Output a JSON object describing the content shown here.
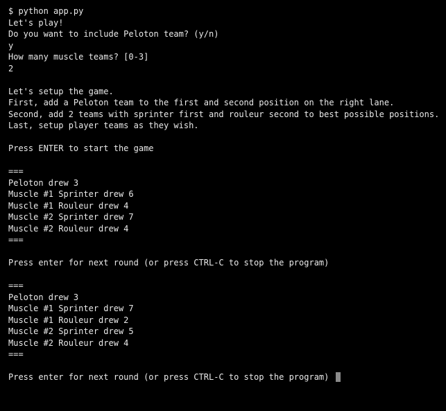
{
  "terminal": {
    "lines": [
      {
        "text": "$ python app.py",
        "name": "command-line"
      },
      {
        "text": "Let's play!",
        "name": "output-line"
      },
      {
        "text": "Do you want to include Peloton team? (y/n)",
        "name": "prompt-peloton"
      },
      {
        "text": "y",
        "name": "input-peloton"
      },
      {
        "text": "How many muscle teams? [0-3]",
        "name": "prompt-muscle-teams"
      },
      {
        "text": "2",
        "name": "input-muscle-teams"
      },
      {
        "text": "",
        "name": "blank-line"
      },
      {
        "text": "Let's setup the game.",
        "name": "output-line"
      },
      {
        "text": "First, add a Peloton team to the first and second position on the right lane.",
        "name": "output-line"
      },
      {
        "text": "Second, add 2 teams with sprinter first and rouleur second to best possible positions.",
        "name": "output-line"
      },
      {
        "text": "Last, setup player teams as they wish.",
        "name": "output-line"
      },
      {
        "text": "",
        "name": "blank-line"
      },
      {
        "text": "Press ENTER to start the game",
        "name": "prompt-start"
      },
      {
        "text": "",
        "name": "blank-line"
      },
      {
        "text": "===",
        "name": "separator"
      },
      {
        "text": "Peloton drew 3",
        "name": "output-line"
      },
      {
        "text": "Muscle #1 Sprinter drew 6",
        "name": "output-line"
      },
      {
        "text": "Muscle #1 Rouleur drew 4",
        "name": "output-line"
      },
      {
        "text": "Muscle #2 Sprinter drew 7",
        "name": "output-line"
      },
      {
        "text": "Muscle #2 Rouleur drew 4",
        "name": "output-line"
      },
      {
        "text": "===",
        "name": "separator"
      },
      {
        "text": "",
        "name": "blank-line"
      },
      {
        "text": "Press enter for next round (or press CTRL-C to stop the program)",
        "name": "prompt-next-round"
      },
      {
        "text": "",
        "name": "blank-line"
      },
      {
        "text": "===",
        "name": "separator"
      },
      {
        "text": "Peloton drew 3",
        "name": "output-line"
      },
      {
        "text": "Muscle #1 Sprinter drew 7",
        "name": "output-line"
      },
      {
        "text": "Muscle #1 Rouleur drew 2",
        "name": "output-line"
      },
      {
        "text": "Muscle #2 Sprinter drew 5",
        "name": "output-line"
      },
      {
        "text": "Muscle #2 Rouleur drew 4",
        "name": "output-line"
      },
      {
        "text": "===",
        "name": "separator"
      },
      {
        "text": "",
        "name": "blank-line"
      },
      {
        "text": "Press enter for next round (or press CTRL-C to stop the program) ",
        "name": "prompt-next-round-active",
        "hasCursor": true
      }
    ]
  }
}
